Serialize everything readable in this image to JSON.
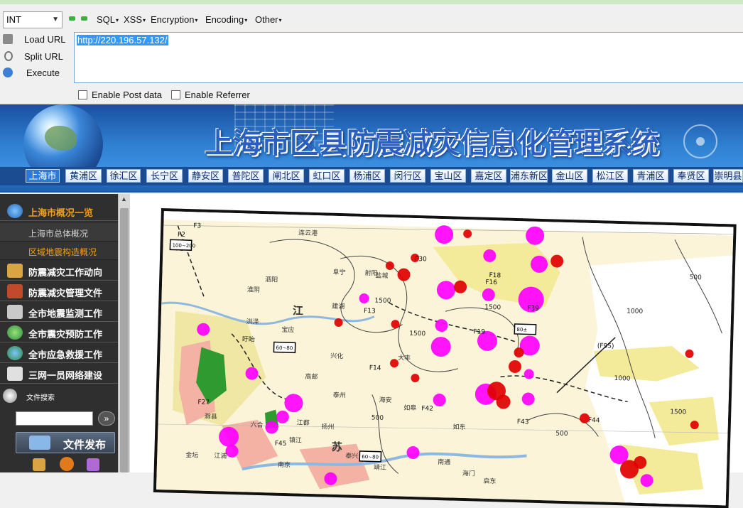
{
  "toolbar": {
    "select_value": "INT",
    "menus": [
      "SQL",
      "XSS",
      "Encryption",
      "Encoding",
      "Other"
    ],
    "commands": [
      "Load URL",
      "Split URL",
      "Execute"
    ],
    "url": "http://220.196.57.132/",
    "checkboxes": [
      "Enable Post data",
      "Enable Referrer"
    ]
  },
  "banner": {
    "title": "上海市区县防震减灾信息化管理系统",
    "districts": [
      "上海市",
      "黄浦区",
      "徐汇区",
      "长宁区",
      "静安区",
      "普陀区",
      "闸北区",
      "虹口区",
      "杨浦区",
      "闵行区",
      "宝山区",
      "嘉定区",
      "浦东新区",
      "金山区",
      "松江区",
      "青浦区",
      "奉贤区",
      "崇明县"
    ]
  },
  "nav": {
    "items": [
      {
        "label": "上海市概况一览",
        "icon": "globe-icon"
      },
      {
        "label": "上海市总体概况",
        "sub": true
      },
      {
        "label": "区域地震构造概况",
        "sub": true,
        "active": true
      },
      {
        "label": "防震减灾工作动向",
        "icon": "scroll-icon"
      },
      {
        "label": "防震减灾管理文件",
        "icon": "books-icon"
      },
      {
        "label": "全市地震监测工作",
        "icon": "satellite-icon"
      },
      {
        "label": "全市震灾预防工作",
        "icon": "prevention-icon"
      },
      {
        "label": "全市应急救援工作",
        "icon": "rescue-icon"
      },
      {
        "label": "三网一员网络建设",
        "icon": "network-icon"
      }
    ],
    "search_label": "文件搜索",
    "search_go": "»",
    "publish_label": "文件发布"
  },
  "colors": {
    "banner_blue": "#2f7fd0",
    "nav_bg": "#2f2f2f",
    "nav_active_text": "#f0a020",
    "quake_magenta": "#ff00ff",
    "quake_red": "#e00000"
  },
  "map": {
    "labels": [
      "连云港",
      "盐城",
      "泗阳",
      "淮阴",
      "阜宁",
      "射阳",
      "建湖",
      "江",
      "宝应",
      "洪泽",
      "盱眙",
      "兴化",
      "大丰",
      "高邮",
      "泰州",
      "海安",
      "如皋",
      "如东",
      "南通",
      "镇江",
      "苏",
      "六合",
      "滁县",
      "江浦",
      "扬州",
      "江都",
      "靖江",
      "泰兴",
      "南京",
      "金坛",
      "海门",
      "启东"
    ],
    "fault_labels": [
      "F1",
      "F2",
      "F3",
      "F13",
      "F14",
      "F16",
      "F18",
      "F19",
      "F27",
      "F30",
      "F39",
      "F42",
      "F43",
      "F44",
      "F45",
      "(F95)"
    ],
    "contours": [
      "1500",
      "1500",
      "1500",
      "1000",
      "500",
      "500",
      "1000",
      "1500",
      "500"
    ],
    "boxes": [
      "100~200",
      "60~80",
      "80±",
      "60~80"
    ]
  }
}
